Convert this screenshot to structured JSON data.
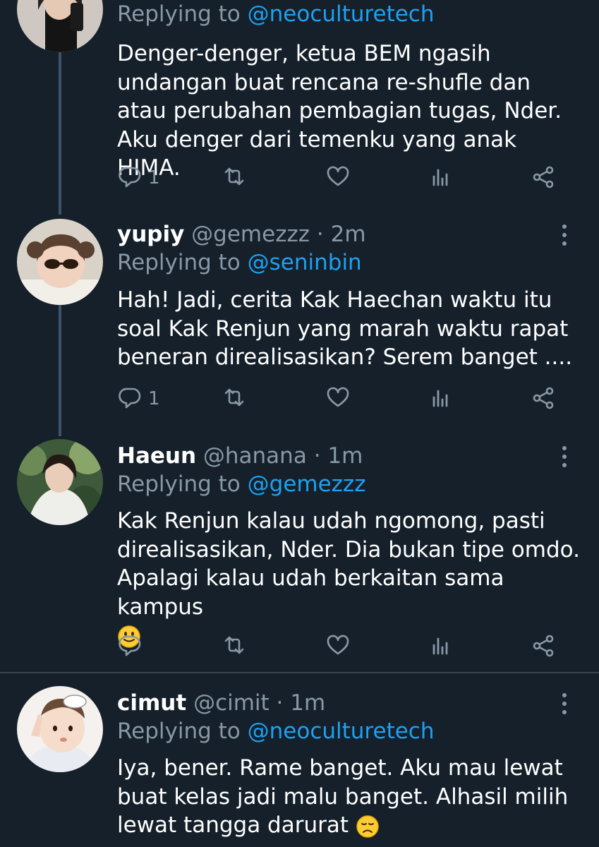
{
  "colors": {
    "background": "#15202b",
    "mention": "#1da1f2",
    "muted": "#8899a6",
    "divider": "#38444d"
  },
  "tweets": [
    {
      "name": "",
      "handle": "",
      "time": "",
      "replying_prefix": "Replying to",
      "replying_to": "@neoculturetech",
      "text": "Denger-denger, ketua BEM ngasih undangan buat rencana re-shufle dan atau perubahan pembagian tugas, Nder. Aku denger dari temenku yang anak HIMA.",
      "reply_count": "1"
    },
    {
      "name": "yupiy",
      "handle": "@gemezzz",
      "separator": "·",
      "time": "2m",
      "replying_prefix": "Replying to",
      "replying_to": "@seninbin",
      "text": "Hah! Jadi, cerita Kak Haechan waktu itu soal Kak Renjun yang marah waktu rapat beneran direalisasikan? Serem banget ....",
      "reply_count": "1"
    },
    {
      "name": "Haeun",
      "handle": "@hanana",
      "separator": "·",
      "time": "1m",
      "replying_prefix": "Replying to",
      "replying_to": "@gemezzz",
      "text": "Kak Renjun kalau udah ngomong, pasti direalisasikan, Nder. Dia bukan tipe omdo. Apalagi kalau udah berkaitan sama kampus",
      "emoji": "slightly-smiling-face",
      "reply_count": ""
    },
    {
      "name": "cimut",
      "handle": "@cimit",
      "separator": "·",
      "time": "1m",
      "replying_prefix": "Replying to",
      "replying_to": "@neoculturetech",
      "text": "Iya, bener. Rame banget. Aku mau lewat buat kelas jadi malu banget. Alhasil milih lewat tangga darurat",
      "emoji": "disappointed-face"
    }
  ],
  "icons": [
    "reply-icon",
    "retweet-icon",
    "like-icon",
    "analytics-icon",
    "share-icon",
    "more-icon"
  ]
}
